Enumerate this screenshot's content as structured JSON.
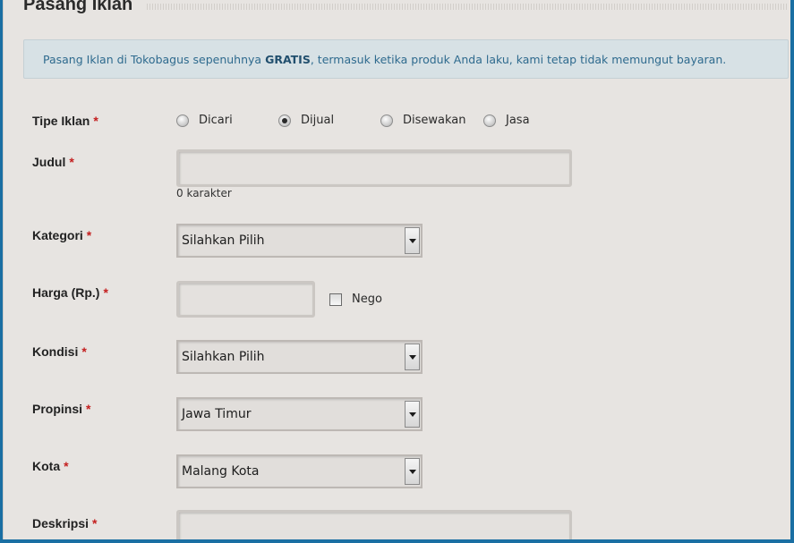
{
  "page": {
    "title": "Pasang Iklan"
  },
  "notice": {
    "text_before": "Pasang Iklan di Tokobagus sepenuhnya ",
    "emphasis": "GRATIS",
    "text_after": ", termasuk ketika produk Anda laku, kami tetap tidak memungut bayaran."
  },
  "required_mark": "*",
  "form": {
    "tipe_iklan": {
      "label": "Tipe Iklan",
      "options": [
        "Dicari",
        "Dijual",
        "Disewakan",
        "Jasa"
      ],
      "selected": "Dijual"
    },
    "judul": {
      "label": "Judul",
      "value": "",
      "char_count": "0 karakter"
    },
    "kategori": {
      "label": "Kategori",
      "selected": "Silahkan Pilih"
    },
    "harga": {
      "label": "Harga (Rp.)",
      "value": "",
      "nego_label": "Nego",
      "nego_checked": false
    },
    "kondisi": {
      "label": "Kondisi",
      "selected": "Silahkan Pilih"
    },
    "propinsi": {
      "label": "Propinsi",
      "selected": "Jawa Timur"
    },
    "kota": {
      "label": "Kota",
      "selected": "Malang Kota"
    },
    "deskripsi": {
      "label": "Deskripsi",
      "value": ""
    }
  },
  "colors": {
    "background": "#e7e4e1",
    "notice_bg": "#d7e1e5",
    "notice_text": "#2e6a8e",
    "required": "#c41e1e",
    "frame_border": "#1a6fa3"
  }
}
